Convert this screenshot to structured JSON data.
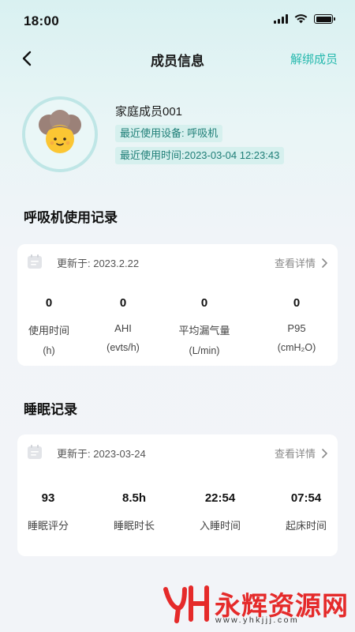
{
  "status_bar": {
    "time": "18:00"
  },
  "nav": {
    "title": "成员信息",
    "action_label": "解绑成员"
  },
  "profile": {
    "name": "家庭成员001",
    "device_tag": "最近使用设备: 呼吸机",
    "last_used_tag": "最近使用时间:2023-03-04 12:23:43"
  },
  "ventilator": {
    "section_title": "呼吸机使用记录",
    "updated_text": "更新于: 2023.2.22",
    "detail_label": "查看详情",
    "metrics": [
      {
        "value": "0",
        "label": "使用时间",
        "unit": "(h)"
      },
      {
        "value": "0",
        "label": "AHI",
        "unit": "(evts/h)"
      },
      {
        "value": "0",
        "label": "平均漏气量",
        "unit": "(L/min)"
      },
      {
        "value": "0",
        "label": "P95",
        "unit": "(cmH₂O)"
      }
    ]
  },
  "sleep": {
    "section_title": "睡眠记录",
    "updated_text": "更新于: 2023-03-24",
    "detail_label": "查看详情",
    "metrics": [
      {
        "value": "93",
        "label": "睡眠评分"
      },
      {
        "value": "8.5h",
        "label": "睡眠时长"
      },
      {
        "value": "22:54",
        "label": "入睡时间"
      },
      {
        "value": "07:54",
        "label": "起床时间"
      }
    ]
  },
  "watermark": {
    "brand": "永辉资源网",
    "url": "www.yhkjjj.com"
  },
  "colors": {
    "accent": "#27b9ae",
    "tag_bg": "#d6f0ee",
    "watermark": "#e52a2a"
  }
}
